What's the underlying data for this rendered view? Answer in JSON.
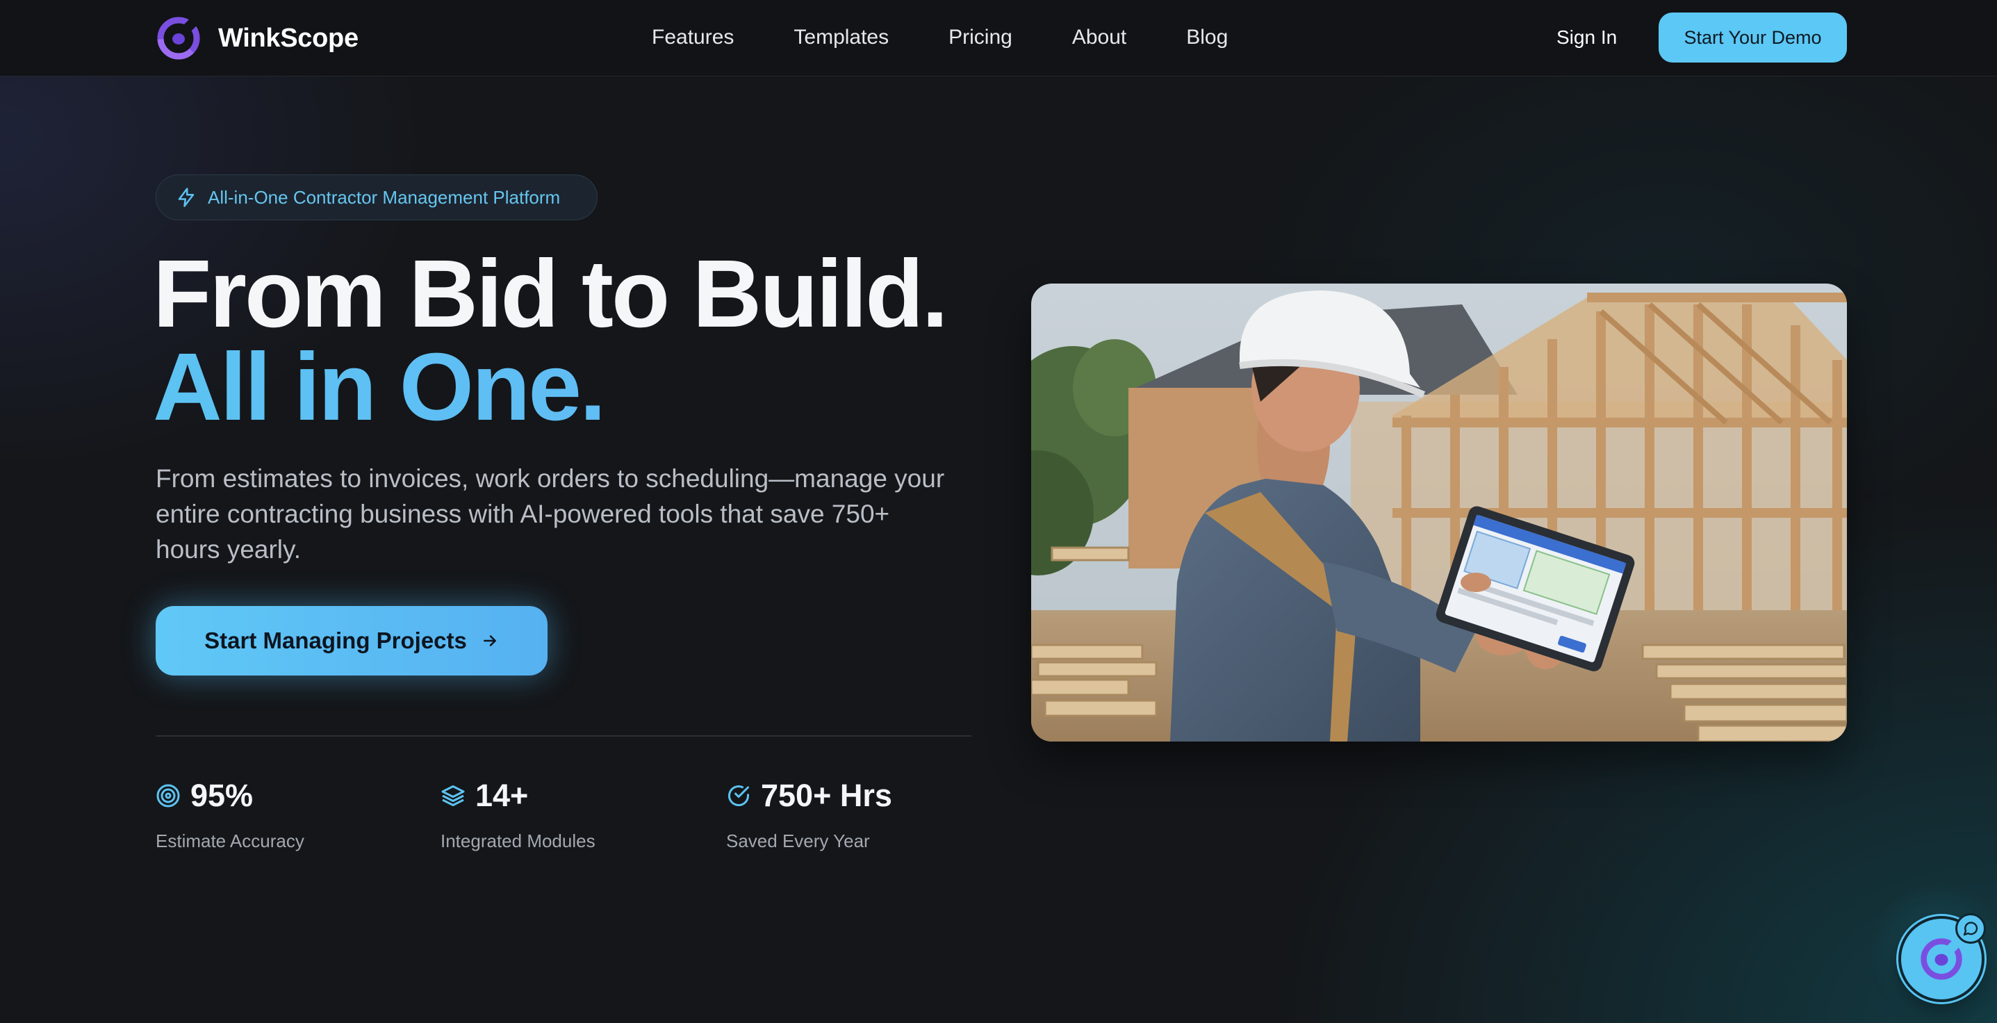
{
  "brand": {
    "name": "WinkScope",
    "logo_icon": "winkscope-logo-icon"
  },
  "nav": {
    "items": [
      {
        "label": "Features"
      },
      {
        "label": "Templates"
      },
      {
        "label": "Pricing"
      },
      {
        "label": "About"
      },
      {
        "label": "Blog"
      }
    ],
    "sign_in_label": "Sign In",
    "demo_label": "Start Your Demo"
  },
  "hero": {
    "badge_icon": "lightning-icon",
    "badge_text": "All-in-One Contractor Management Platform",
    "headline_line1": "From Bid to Build.",
    "headline_line2": "All in One.",
    "subheading": "From estimates to invoices, work orders to scheduling—manage your entire contracting business with AI-powered tools that save 750+ hours yearly.",
    "cta_label": "Start Managing Projects",
    "cta_icon": "arrow-right-icon",
    "image_alt": "Contractor in hard hat using a tablet at a house framing construction site"
  },
  "stats": [
    {
      "icon": "target-icon",
      "value": "95%",
      "label": "Estimate Accuracy"
    },
    {
      "icon": "layers-icon",
      "value": "14+",
      "label": "Integrated Modules"
    },
    {
      "icon": "check-circle-icon",
      "value": "750+ Hrs",
      "label": "Saved Every Year"
    }
  ],
  "chat_widget": {
    "icon": "winkscope-chat-icon",
    "badge_icon": "message-icon"
  },
  "colors": {
    "accent": "#5cc8f5",
    "accent_blue": "#56b1f1",
    "background": "#141619",
    "header_bg": "#121316",
    "logo_purple": "#7a4fe0",
    "text_primary": "#f5f6f8",
    "text_muted": "#b9bec7"
  }
}
